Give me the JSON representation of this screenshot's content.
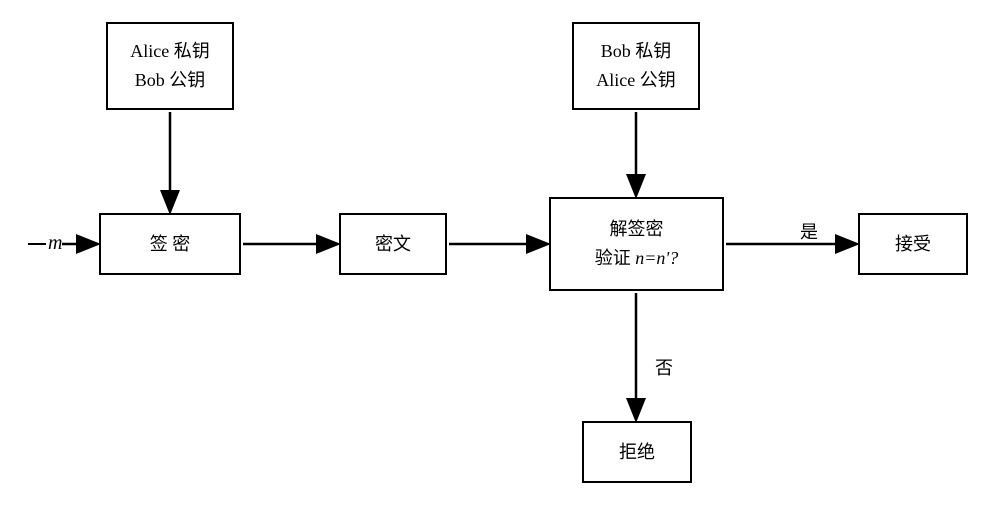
{
  "input_label": "m",
  "keys_left": {
    "line1": "Alice 私钥",
    "line2": "Bob 公钥"
  },
  "keys_right": {
    "line1": "Bob 私钥",
    "line2": "Alice 公钥"
  },
  "signcrypt": "签 密",
  "cipher": "密文",
  "unsigncrypt": {
    "line1": "解签密",
    "verify_prefix": "验证 ",
    "verify_expr": "n=n'?"
  },
  "accept": "接受",
  "reject": "拒绝",
  "yes": "是",
  "no": "否"
}
